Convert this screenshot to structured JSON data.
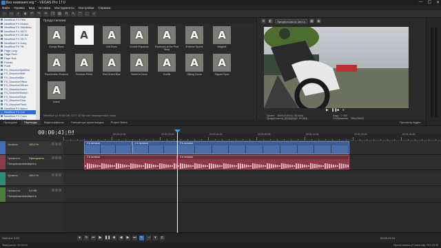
{
  "window": {
    "title": "Без названия.veg * - VEGAS Pro 17.0",
    "buttons": [
      "—",
      "☐",
      "✕"
    ]
  },
  "menu": [
    "Файл",
    "Правка",
    "Вид",
    "Вставка",
    "Инструменты",
    "Настройки",
    "Справка"
  ],
  "tree": {
    "items": [
      "NewBlue FX Film",
      "NewBlue FX Motion",
      "NewBlue FX Stabilizer",
      "NewBlue FX 3D Ti",
      "NewBlue FX 3D Mo",
      "NewBlue FX 3D Ti",
      "NewBlue FX Hairy",
      "NewBlue FX Tilt",
      "Page Loop",
      "Page Peel",
      "Page Roll",
      "Portals",
      "Push",
      "FX_DissolveSplitBlur",
      "FX_DissolveShift",
      "FX_DissolveBlur",
      "FX_DissolveOffset",
      "FX_DissolveDiffuse",
      "FX_DissolveZoom",
      "FX_DissolveMotion",
      "FX_DissolveEdge",
      "FX_DissolveGlow",
      "FX_DissolveFlash",
      "NewBlue FX Blend",
      "NewBlue FX Cut",
      "NewBlue FX Color",
      "NewBlue FX Elem",
      "NewBlue FX Diss"
    ],
    "selected_index": 24
  },
  "presets": {
    "header": "Предустановки:",
    "items": [
      "Bumpy Blues",
      "",
      "Dirt Road",
      "Double Exposure",
      "Explosion at the Print Shop",
      "Extreme Sports",
      "Magenit",
      "Psychedelic Pinaboot",
      "Random Prints",
      "Red Green Blue",
      "Sweet to None",
      "Shuffle",
      "Sliding Doors",
      "Slipped Sync",
      "Inartul"
    ],
    "selected_index": 1,
    "status": "NewBlue Lit RGB Diff, DXT, 32 бутона помещенные точка"
  },
  "preview": {
    "mode": "Предпросмотр (авто)",
    "info_left": "Проект:   3840x2160x32, 59,940p\nПредпросмотр: 960x540x32, 59,940p\nОтображение: 351x198x32",
    "info_right": "Кадр:   2 468\nОтображение:   386x198x32"
  },
  "tabs": [
    "Проводник",
    "Переходы",
    "Видеоэффекты",
    "Генераторы мультимедиа",
    "Project Notes"
  ],
  "active_tab": 1,
  "preview_tab": "Просмотр видео",
  "timeline": {
    "timecode": "00:00:41:04",
    "ruler": [
      "00:00:00",
      "00:00:15:00",
      "00:00:29:29",
      "00:00:44:29",
      "00:00:59:28",
      "00:01:14:28",
      "00:01:29:29",
      "00:01:44:29"
    ],
    "tracks": [
      {
        "num": "1",
        "type": "video",
        "label": "Уровень:",
        "value": "100,0 %",
        "color": "#3f6fb8"
      },
      {
        "num": "2",
        "type": "audio",
        "label": "Громкость:",
        "value": "Приглушено",
        "label2": "Панорамирование:",
        "value2": "Центр",
        "color": "#8b3a4a"
      },
      {
        "num": "3",
        "type": "video",
        "label": "Уровень:",
        "value": "100,0 %",
        "color": "#2e8c7a"
      },
      {
        "num": "4",
        "type": "audio",
        "label": "Громкость:",
        "value": "0,0 dB",
        "label2": "Панорамирование:",
        "value2": "Центр",
        "color": "#4b7c3a"
      }
    ],
    "clip_label": "2 в полоски"
  },
  "bottom": {
    "rate": "Частота: 0,00",
    "end_tc": "00:00:41:04",
    "length": "00:02:12:24"
  },
  "status": {
    "left": "Завершено: 00:00:23",
    "right": "Время записи (2 каналов): 241:29:35"
  }
}
